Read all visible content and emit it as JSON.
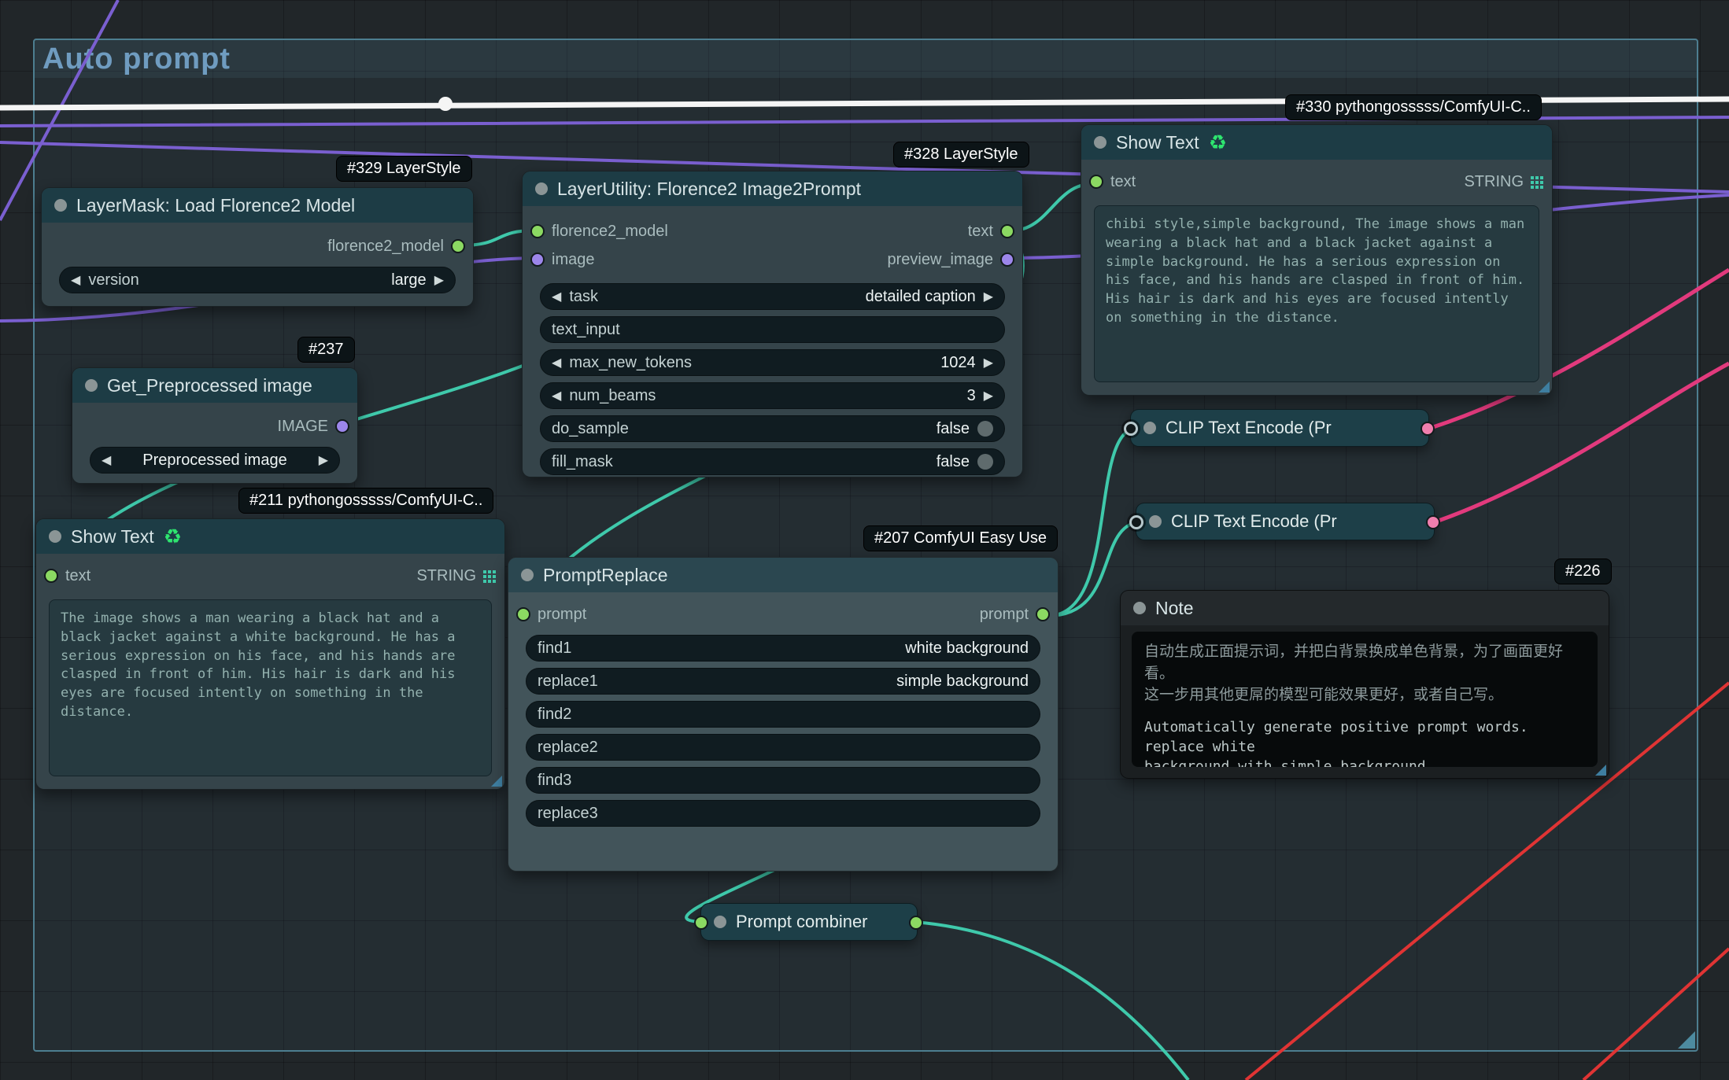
{
  "group": {
    "title": "Auto prompt"
  },
  "icons": {
    "combo_left": "◀",
    "combo_right": "▶",
    "refresh": "♻"
  },
  "colors": {
    "accent": "#3fc9ab",
    "purple": "#7a5fd0",
    "pink": "#e23a7d",
    "red": "#e03434",
    "white-wire": "#f5f5f5",
    "green-slot": "#8bd962",
    "purple-slot": "#9c86ea",
    "title-text": "#d7e4e6"
  },
  "badges": {
    "n329": "#329 LayerStyle",
    "n328": "#328 LayerStyle",
    "n237": "#237",
    "n211": "#211 pythongosssss/ComfyUI-C..",
    "n330": "#330 pythongosssss/ComfyUI-C..",
    "n207": "#207 ComfyUI Easy Use",
    "n226": "#226"
  },
  "nodes": {
    "load_florence2": {
      "title": "LayerMask: Load Florence2 Model",
      "output_label": "florence2_model",
      "version_label": "version",
      "version_value": "large"
    },
    "florence2": {
      "title": "LayerUtility: Florence2 Image2Prompt",
      "in_model": "florence2_model",
      "in_image": "image",
      "out_text": "text",
      "out_preview": "preview_image",
      "widgets": [
        {
          "label": "task",
          "value": "detailed caption"
        },
        {
          "label": "text_input",
          "value": ""
        },
        {
          "label": "max_new_tokens",
          "value": "1024"
        },
        {
          "label": "num_beams",
          "value": "3"
        },
        {
          "label": "do_sample",
          "value": "false"
        },
        {
          "label": "fill_mask",
          "value": "false"
        }
      ]
    },
    "get_preprocessed": {
      "title": "Get_Preprocessed image",
      "output_label": "IMAGE",
      "widget_value": "Preprocessed image"
    },
    "show_text_211": {
      "title": "Show Text",
      "in_label": "text",
      "out_label": "STRING",
      "content": "The image shows a man wearing a black hat and a black jacket against a white background. He has a serious expression on his face, and his hands are clasped in front of him. His hair is dark and his eyes are focused intently on something in the distance."
    },
    "show_text_330": {
      "title": "Show Text",
      "in_label": "text",
      "out_label": "STRING",
      "content": "chibi style,simple background, The image shows a man wearing a black hat and a black jacket against a simple background. He has a serious expression on his face, and his hands are clasped in front of him. His hair is dark and his eyes are focused intently on something in the distance."
    },
    "prompt_replace": {
      "title": "PromptReplace",
      "in_label": "prompt",
      "out_label": "prompt",
      "widgets": [
        {
          "label": "find1",
          "value": "white background"
        },
        {
          "label": "replace1",
          "value": "simple background"
        },
        {
          "label": "find2",
          "value": ""
        },
        {
          "label": "replace2",
          "value": ""
        },
        {
          "label": "find3",
          "value": ""
        },
        {
          "label": "replace3",
          "value": ""
        }
      ]
    },
    "clip1": {
      "title": "CLIP Text Encode (Pr"
    },
    "clip2": {
      "title": "CLIP Text Encode (Pr"
    },
    "note": {
      "title": "Note",
      "cn": "自动生成正面提示词，并把白背景换成单色背景，为了画面更好看。\n这一步用其他更屌的模型可能效果更好，或者自己写。",
      "en": "Automatically generate positive prompt words. replace white\nbackground with simple background.\nThis step can also be achieved using other ollama models."
    },
    "prompt_combiner": {
      "title": "Prompt combiner"
    }
  }
}
